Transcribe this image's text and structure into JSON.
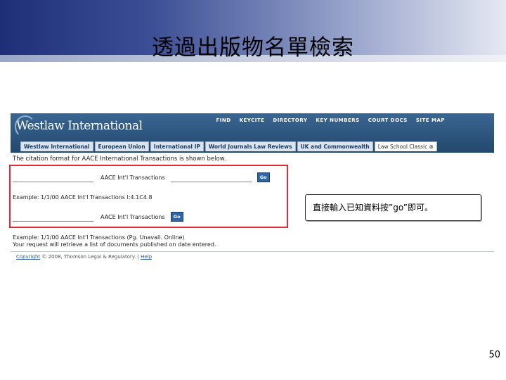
{
  "slide": {
    "title": "透過出版物名單檢索",
    "callout": "直接輸入已知資料按”go”即可。",
    "page_number": "50"
  },
  "westlaw": {
    "logo": "Westlaw International",
    "top_nav": [
      "FIND",
      "KEYCITE",
      "DIRECTORY",
      "KEY NUMBERS",
      "COURT DOCS",
      "SITE MAP"
    ],
    "tabs": [
      "Westlaw International",
      "European Union",
      "International IP",
      "World Journals Law Reviews",
      "UK and Commonwealth",
      "Law School Classic ⊗"
    ],
    "active_tab": "Law School Classic ⊗",
    "citation_message": "The citation format for AACE International Transactions is shown below.",
    "form1": {
      "label": "AACE Int'l Transactions",
      "go_label": "Go",
      "example": "Example: 1/1/00 AACE Int'l Transactions I:4.1C4.8"
    },
    "form2": {
      "label": "AACE Int'l Transactions",
      "go_label": "Go",
      "example": "Example: 1/1/00 AACE Int'l Transactions (Pg. Unavail. Online)"
    },
    "request_note": "Your request will retrieve a list of documents published on date entered.",
    "footer": {
      "copyright_link": "Copyright",
      "copyright_text": "© 2008, Thomson Legal & Regulatory. |",
      "help_link": "Help"
    }
  }
}
